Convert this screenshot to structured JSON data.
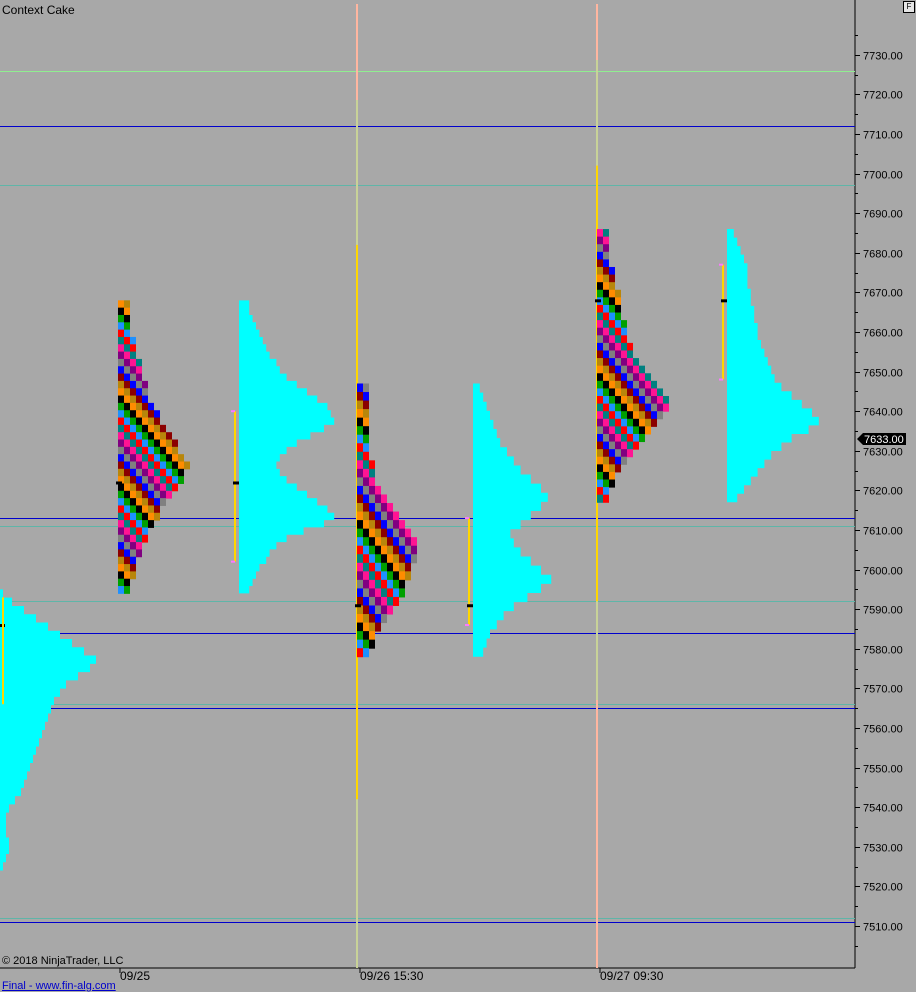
{
  "window": {
    "title": "Context Cake",
    "copyright": "© 2018 NinjaTrader, LLC",
    "footer_link": "Final - www.fin-alg.com",
    "format_button": "F"
  },
  "chart_data": {
    "type": "market-profile",
    "title": "Context Cake",
    "ylim": [
      7500,
      7735
    ],
    "y_tick_step": 10,
    "y_tick_labels": [
      "7510.00",
      "7520.00",
      "7530.00",
      "7540.00",
      "7550.00",
      "7560.00",
      "7570.00",
      "7580.00",
      "7590.00",
      "7600.00",
      "7610.00",
      "7620.00",
      "7630.00",
      "7640.00",
      "7650.00",
      "7660.00",
      "7670.00",
      "7680.00",
      "7690.00",
      "7700.00",
      "7710.00",
      "7720.00",
      "7730.00"
    ],
    "x_labels": [
      "09/25",
      "09/26 15:30",
      "09/27 09:30"
    ],
    "last_price": 7633.0,
    "last_price_label": "7633.00",
    "grid": false,
    "colors": {
      "background": "#a8a8a8",
      "volume_profile": "#00ffff",
      "level_line": "#0000cc",
      "session_divider": "#ffb6a0",
      "tpo_palette": [
        "#ff8c00",
        "#800080",
        "#00a000",
        "#0000ff",
        "#ff0000",
        "#b8860b",
        "#ff1493",
        "#000000",
        "#808080",
        "#1e90ff",
        "#8b0000",
        "#008080"
      ]
    },
    "horizontal_levels": [
      {
        "price": 7726.0,
        "color": "#90ee90"
      },
      {
        "price": 7712.0,
        "color": "#0000cc"
      },
      {
        "price": 7697.0,
        "color": "#5fb5a8"
      },
      {
        "price": 7613.0,
        "color": "#0000cc"
      },
      {
        "price": 7611.0,
        "color": "#5fb5a8"
      },
      {
        "price": 7592.0,
        "color": "#5fb5a8"
      },
      {
        "price": 7584.0,
        "color": "#0000cc"
      },
      {
        "price": 7566.0,
        "color": "#5fb5a8"
      },
      {
        "price": 7565.0,
        "color": "#0000cc"
      },
      {
        "price": 7512.0,
        "color": "#5fb5a8"
      },
      {
        "price": 7511.0,
        "color": "#0000cc"
      }
    ],
    "sessions": [
      {
        "label": "09/25",
        "high": 7668,
        "low": 7594,
        "poc": 7622,
        "va_high": 7640,
        "va_low": 7602,
        "tpo_width": [
          2,
          2,
          2,
          2,
          2,
          3,
          3,
          3,
          4,
          4,
          4,
          5,
          5,
          5,
          6,
          7,
          7,
          8,
          9,
          10,
          10,
          11,
          12,
          11,
          11,
          10,
          9,
          8,
          7,
          7,
          6,
          5,
          5,
          4,
          4,
          3,
          3,
          3,
          2,
          2
        ],
        "volume": [
          3,
          3,
          4,
          5,
          6,
          7,
          8,
          9,
          11,
          12,
          14,
          17,
          20,
          23,
          26,
          27,
          28,
          25,
          21,
          17,
          14,
          12,
          11,
          12,
          14,
          17,
          20,
          23,
          26,
          28,
          25,
          19,
          14,
          11,
          9,
          8,
          6,
          5,
          4,
          3
        ]
      },
      {
        "label": "09/26 15:30",
        "high": 7647,
        "low": 7578,
        "poc": 7591,
        "va_high": 7613,
        "va_low": 7586,
        "tpo_width": [
          2,
          2,
          2,
          2,
          2,
          2,
          2,
          2,
          2,
          3,
          3,
          3,
          4,
          5,
          6,
          7,
          8,
          9,
          10,
          10,
          10,
          9,
          9,
          8,
          8,
          7,
          6,
          5,
          4,
          3,
          3,
          2
        ],
        "volume": [
          2,
          3,
          4,
          5,
          6,
          7,
          8,
          10,
          12,
          14,
          17,
          20,
          22,
          20,
          17,
          14,
          11,
          12,
          14,
          17,
          20,
          23,
          20,
          16,
          12,
          9,
          7,
          5,
          4,
          3
        ]
      },
      {
        "label": "09/27 09:30",
        "high": 7686,
        "low": 7617,
        "poc": 7668,
        "va_high": 7677,
        "va_low": 7648,
        "tpo_width": [
          2,
          2,
          2,
          2,
          2,
          3,
          3,
          3,
          4,
          4,
          4,
          4,
          5,
          5,
          5,
          6,
          6,
          7,
          8,
          9,
          10,
          11,
          12,
          12,
          11,
          10,
          9,
          8,
          7,
          6,
          5,
          4,
          3,
          3,
          2,
          2
        ],
        "volume": [
          2,
          3,
          4,
          5,
          6,
          6,
          6,
          7,
          7,
          8,
          8,
          9,
          9,
          10,
          11,
          12,
          13,
          14,
          16,
          19,
          22,
          25,
          27,
          24,
          19,
          16,
          13,
          11,
          9,
          7,
          5,
          3
        ]
      }
    ]
  }
}
